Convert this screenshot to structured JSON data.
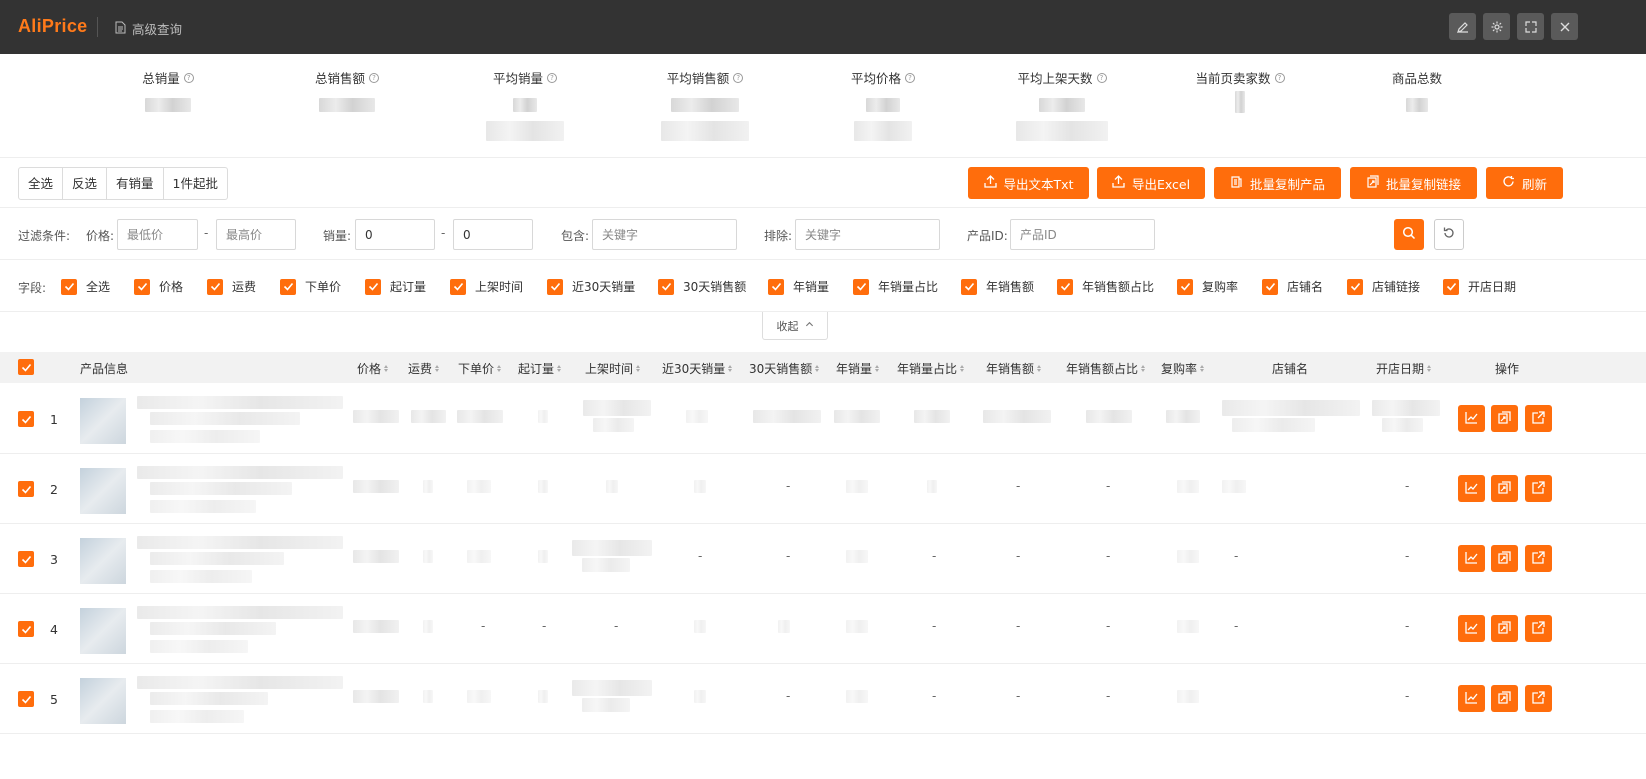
{
  "header": {
    "logo": "AliPrice",
    "breadcrumb": "高级查询",
    "window_buttons": [
      "edit-icon",
      "settings-icon",
      "fullscreen-icon",
      "close-icon"
    ]
  },
  "stats": [
    {
      "label": "总销量",
      "help": "?"
    },
    {
      "label": "总销售额",
      "help": "?"
    },
    {
      "label": "平均销量",
      "help": "?"
    },
    {
      "label": "平均销售额",
      "help": "?"
    },
    {
      "label": "平均价格",
      "help": "?"
    },
    {
      "label": "平均上架天数",
      "help": "?"
    },
    {
      "label": "当前页卖家数",
      "help": "?"
    },
    {
      "label": "商品总数"
    }
  ],
  "toolbar": {
    "segments": [
      "全选",
      "反选",
      "有销量",
      "1件起批"
    ],
    "actions": [
      "导出文本Txt",
      "导出Excel",
      "批量复制产品",
      "批量复制链接",
      "刷新"
    ]
  },
  "filter": {
    "title": "过滤条件:",
    "price_label": "价格:",
    "price_min_placeholder": "最低价",
    "price_max_placeholder": "最高价",
    "sales_label": "销量:",
    "sales_min": "0",
    "sales_max": "0",
    "include_label": "包含:",
    "include_placeholder": "关键字",
    "exclude_label": "排除:",
    "exclude_placeholder": "关键字",
    "pid_label": "产品ID:",
    "pid_placeholder": "产品ID",
    "dash": "-"
  },
  "fields": {
    "title": "字段:",
    "items": [
      "全选",
      "价格",
      "运费",
      "下单价",
      "起订量",
      "上架时间",
      "近30天销量",
      "30天销售额",
      "年销量",
      "年销量占比",
      "年销售额",
      "年销售额占比",
      "复购率",
      "店铺名",
      "店铺链接",
      "开店日期"
    ]
  },
  "collapse_label": "收起",
  "table": {
    "headers": {
      "product": "产品信息",
      "price": "价格",
      "freight": "运费",
      "order_price": "下单价",
      "moq": "起订量",
      "listed": "上架时间",
      "sales30": "近30天销量",
      "rev30": "30天销售额",
      "year_sales": "年销量",
      "year_sales_pct": "年销量占比",
      "year_rev": "年销售额",
      "year_rev_pct": "年销售额占比",
      "repurchase": "复购率",
      "shop": "店铺名",
      "open_date": "开店日期",
      "actions": "操作"
    },
    "rows": [
      {
        "index": "1",
        "dashes": {}
      },
      {
        "index": "2",
        "dashes": {
          "rev30": "-",
          "year_rev": "-",
          "year_rev_pct": "-",
          "open_date": "-"
        }
      },
      {
        "index": "3",
        "dashes": {
          "sales30": "-",
          "rev30": "-",
          "year_sales_pct": "-",
          "year_rev": "-",
          "year_rev_pct": "-",
          "shop": "-",
          "open_date": "-"
        }
      },
      {
        "index": "4",
        "dashes": {
          "order_price": "-",
          "moq": "-",
          "listed": "-",
          "year_sales_pct": "-",
          "year_rev": "-",
          "year_rev_pct": "-",
          "shop": "-",
          "open_date": "-"
        }
      },
      {
        "index": "5",
        "dashes": {
          "rev30": "-",
          "year_sales_pct": "-",
          "year_rev": "-",
          "year_rev_pct": "-",
          "open_date": "-"
        }
      }
    ],
    "row_actions": [
      "trend-chart-icon",
      "copy-icon",
      "open-link-icon"
    ]
  },
  "colors": {
    "accent": "#ff6d0c",
    "header_bg": "#333333",
    "logo": "#ff7a1a"
  }
}
